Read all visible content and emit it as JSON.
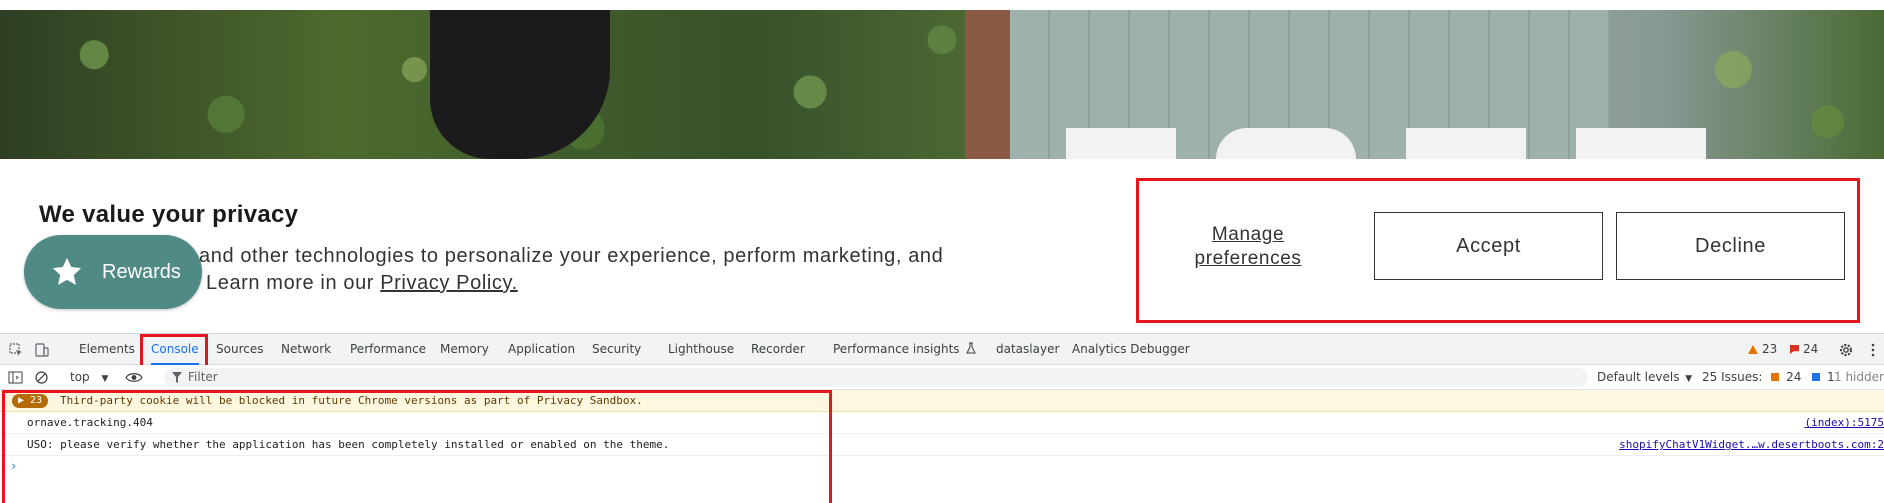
{
  "banner": {
    "title": "We value your privacy",
    "text_part1": "and other technologies to personalize your experience, perform marketing, and",
    "text_part2": "Learn more in our",
    "policy_link": "Privacy Policy.",
    "manage_preferences": "Manage preferences",
    "accept": "Accept",
    "decline": "Decline",
    "rewards": "Rewards"
  },
  "devtools": {
    "tabs": [
      "Elements",
      "Console",
      "Sources",
      "Network",
      "Performance",
      "Memory",
      "Application",
      "Security",
      "Lighthouse",
      "Recorder",
      "Performance insights",
      "dataslayer",
      "Analytics Debugger"
    ],
    "active_tab": "Console",
    "warnings_count": "23",
    "errors_count": "24",
    "toolbar": {
      "context": "top",
      "filter_placeholder": "Filter",
      "levels": "Default levels",
      "issues_label": "25 Issues:",
      "issues_warn": "24",
      "issues_info": "1",
      "hidden": "1 hidden"
    },
    "messages": [
      {
        "badge": "23",
        "text": "Third-party cookie will be blocked in future Chrome versions as part of Privacy Sandbox.",
        "source": ""
      },
      {
        "text": "ornave.tracking.404",
        "source": "(index):5175"
      },
      {
        "text": "USO: please verify whether the application has been completely installed or enabled on the theme.",
        "source": "shopifyChatV1Widget.…w.desertboots.com:2"
      }
    ],
    "prompt": "›"
  },
  "colors": {
    "accent_red": "#e8141c",
    "rewards_teal": "#4f8a85",
    "devtools_blue": "#1a73e8"
  }
}
